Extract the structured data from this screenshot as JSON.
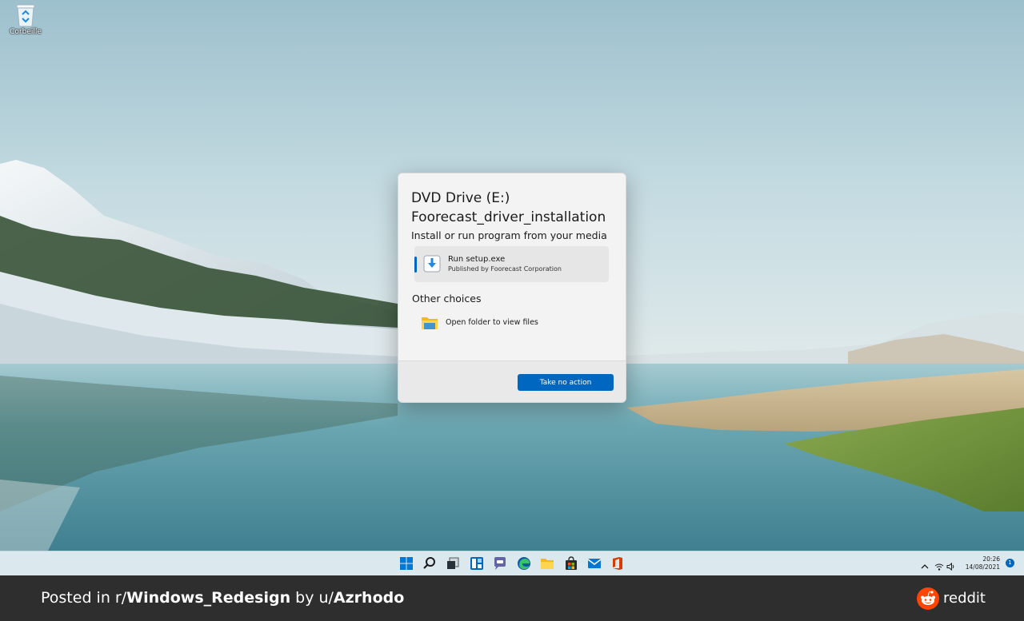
{
  "desktop": {
    "icons": [
      {
        "label": "Corbeille",
        "icon": "recycle-bin-icon"
      }
    ]
  },
  "dialog": {
    "title_line1": "DVD Drive (E:)",
    "title_line2": "Foorecast_driver_installation",
    "subtitle": "Install or run program from your media",
    "run_option": {
      "label": "Run setup.exe",
      "publisher": "Published by Foorecast Corporation",
      "icon": "install-download-icon"
    },
    "other_choices_heading": "Other choices",
    "folder_option": {
      "label": "Open folder to view files",
      "icon": "folder-icon"
    },
    "action_button": "Take no action",
    "accent_color": "#0067c0"
  },
  "taskbar": {
    "apps": [
      "start-icon",
      "search-icon",
      "task-view-icon",
      "widgets-icon",
      "teams-chat-icon",
      "edge-icon",
      "file-explorer-icon",
      "store-icon",
      "mail-icon",
      "office-icon"
    ],
    "tray": [
      "chevron-up-icon",
      "wifi-icon",
      "speaker-icon"
    ],
    "time": "20:26",
    "date": "14/08/2021",
    "notification_count": "1"
  },
  "caption": {
    "prefix": "Posted in r/",
    "subreddit": "Windows_Redesign",
    "by": " by u/",
    "user": "Azrhodo",
    "brand": "reddit",
    "brand_color": "#ff4500"
  }
}
